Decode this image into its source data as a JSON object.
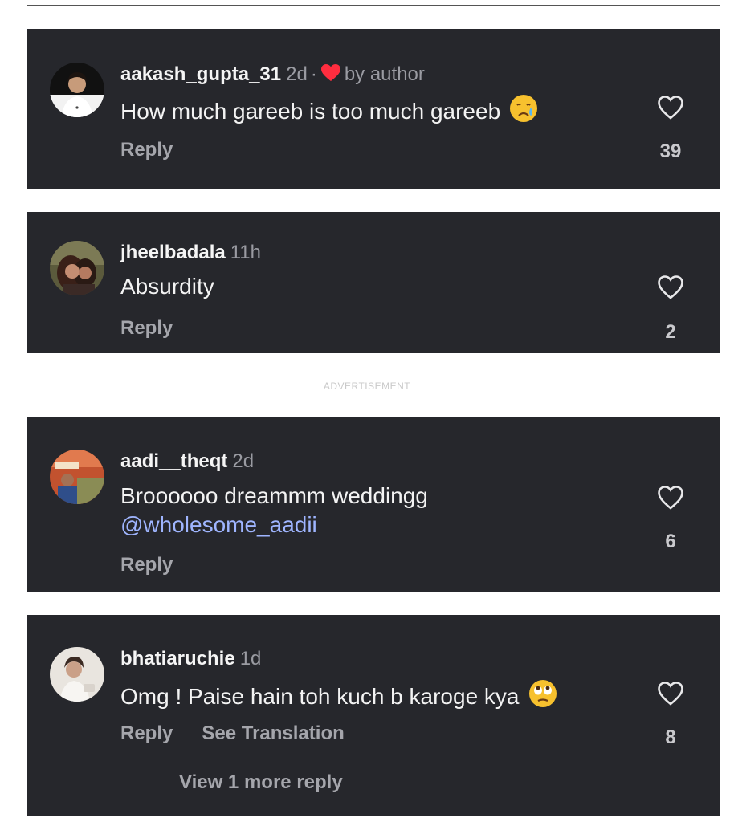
{
  "colors": {
    "card_bg": "#26272c",
    "text": "#f3f3f3",
    "muted": "#9a9ba2",
    "mention": "#9fb5ff",
    "heart_red": "#ff2d3f"
  },
  "advertisement_label": "ADVERTISEMENT",
  "comments": [
    {
      "username": "aakash_gupta_31",
      "time": "2d",
      "separator": "·",
      "badge_icon": "heart-icon",
      "badge_text": "by author",
      "text": "How much gareeb is too much gareeb",
      "emoji": "crying-face-emoji",
      "reply_label": "Reply",
      "likes": "39"
    },
    {
      "username": "jheelbadala",
      "time": "11h",
      "text": "Absurdity",
      "reply_label": "Reply",
      "likes": "2"
    },
    {
      "username": "aadi__theqt",
      "time": "2d",
      "text": "Broooooo dreammm weddingg",
      "mention": "@wholesome_aadii",
      "reply_label": "Reply",
      "likes": "6"
    },
    {
      "username": "bhatiaruchie",
      "time": "1d",
      "text": "Omg ! Paise hain toh kuch b karoge kya",
      "emoji": "eye-roll-emoji",
      "reply_label": "Reply",
      "translation_label": "See Translation",
      "likes": "8",
      "more_replies_label": "View 1 more reply"
    }
  ]
}
